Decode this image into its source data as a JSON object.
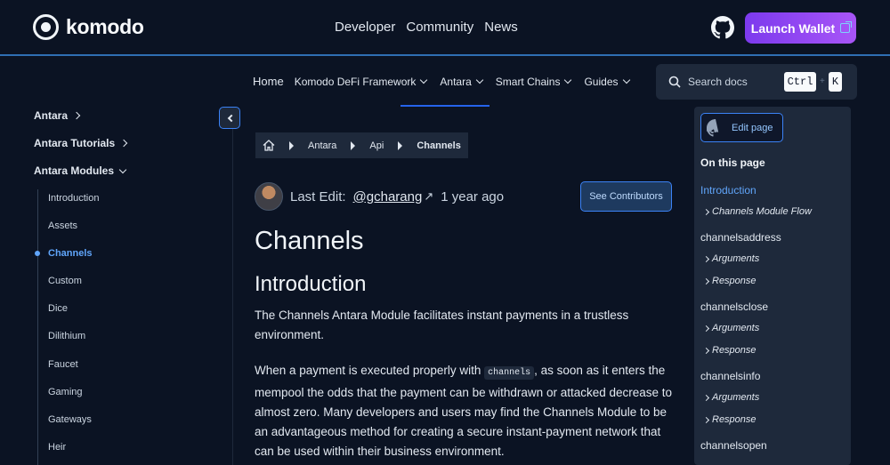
{
  "header": {
    "logo_text": "komodo",
    "nav": [
      "Developer",
      "Community",
      "News"
    ],
    "launch_label": "Launch Wallet"
  },
  "subnav": {
    "home": "Home",
    "items": [
      "Komodo DeFi Framework",
      "Antara",
      "Smart Chains",
      "Guides"
    ],
    "active": "Antara"
  },
  "search": {
    "placeholder": "Search docs",
    "kbd_ctrl": "Ctrl",
    "kbd_plus": "+",
    "kbd_k": "K"
  },
  "sidebar": {
    "sections": [
      {
        "label": "Antara",
        "expanded": false
      },
      {
        "label": "Antara Tutorials",
        "expanded": false
      },
      {
        "label": "Antara Modules",
        "expanded": true
      }
    ],
    "items": [
      "Introduction",
      "Assets",
      "Channels",
      "Custom",
      "Dice",
      "Dilithium",
      "Faucet",
      "Gaming",
      "Gateways",
      "Heir"
    ],
    "active_item": "Channels"
  },
  "breadcrumb": [
    "Antara",
    "Api",
    "Channels"
  ],
  "meta": {
    "last_edit_label": "Last Edit:",
    "author": "@gcharang",
    "arrow": "↗",
    "ago": "1 year ago",
    "contributors_label": "See Contributors"
  },
  "content": {
    "title": "Channels",
    "section": "Introduction",
    "p1": "The Channels Antara Module facilitates instant payments in a trustless environment.",
    "p2_before": "When a payment is executed properly with ",
    "p2_code": "channels",
    "p2_after": ", as soon as it enters the mempool the odds that the payment can be withdrawn or attacked decrease to almost zero. Many developers and users may find the Channels Module to be an advantageous method for creating a secure instant-payment network that can be used within their business environment."
  },
  "toc": {
    "edit_label": "Edit page",
    "heading": "On this page",
    "entries": [
      {
        "label": "Introduction",
        "level": 1,
        "active": true
      },
      {
        "label": "Channels Module Flow",
        "level": 2
      },
      {
        "label": "channelsaddress",
        "level": 1
      },
      {
        "label": "Arguments",
        "level": 2
      },
      {
        "label": "Response",
        "level": 2
      },
      {
        "label": "channelsclose",
        "level": 1
      },
      {
        "label": "Arguments",
        "level": 2
      },
      {
        "label": "Response",
        "level": 2
      },
      {
        "label": "channelsinfo",
        "level": 1
      },
      {
        "label": "Arguments",
        "level": 2
      },
      {
        "label": "Response",
        "level": 2
      },
      {
        "label": "channelsopen",
        "level": 1
      }
    ]
  },
  "colors": {
    "accent": "#3b82f6",
    "launch_gradient_start": "#7c3aed",
    "launch_gradient_end": "#a855f7",
    "background": "#0b1323"
  }
}
